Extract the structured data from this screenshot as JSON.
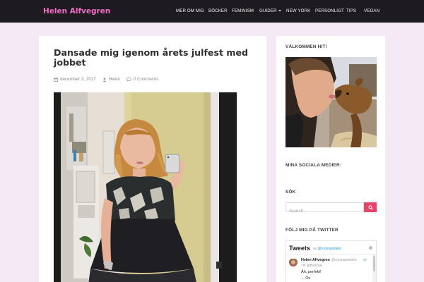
{
  "site": {
    "brand": "Helen Alfvegren"
  },
  "nav": {
    "items": [
      {
        "label": "MER OM MIG"
      },
      {
        "label": "BÖCKER"
      },
      {
        "label": "FEMINISM"
      },
      {
        "label": "GUIDER"
      },
      {
        "label": "NEW YORK"
      },
      {
        "label": "PERSONLIGT"
      },
      {
        "label": "TIPS"
      },
      {
        "label": "VEGAN"
      }
    ]
  },
  "post": {
    "title": "Dansade mig igenom årets julfest med jobbet",
    "date": "december 3, 2017",
    "author": "Helen",
    "comments": "0 Comments"
  },
  "sidebar": {
    "welcome_heading": "VÄLKOMMEN HIT!",
    "social_heading": "MINA SOCIALA MEDIER:",
    "search_heading": "SÖK",
    "search_placeholder": "Search...",
    "twitter_heading": "FÖLJ MIG PÅ TWITTER"
  },
  "twitter": {
    "title": "Tweets",
    "by_prefix": "av",
    "by_handle": "@rockspindeln",
    "tweet": {
      "name": "Helen Alfvegren",
      "handle": "@rockspindeln",
      "reply_to": "Till @theryaa",
      "text": "Åh, perfekt!",
      "more": "... Öv"
    }
  },
  "colors": {
    "brand": "#f06bc6",
    "topbar": "#1d1b1f",
    "page_bg": "#f4e9f5",
    "search_button": "#e9436a",
    "twitter_link": "#1b95e0"
  },
  "icons": {
    "date": "calendar-icon",
    "author": "user-icon",
    "comments": "comment-icon",
    "search": "search-icon",
    "guider_dropdown": "caret-down-icon",
    "tweet_source": "twitter-bird-icon"
  }
}
